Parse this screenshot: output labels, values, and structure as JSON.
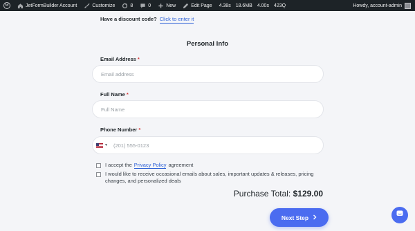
{
  "adminbar": {
    "site_name": "JetFormBuilder Account",
    "customize": "Customize",
    "updates_count": "8",
    "comments_count": "0",
    "new_label": "New",
    "edit_page": "Edit Page",
    "metrics": [
      "4.38s",
      "18.6MB",
      "4.00s",
      "423Q"
    ],
    "howdy": "Howdy, account-admin"
  },
  "discount": {
    "label": "Have a discount code?",
    "link": "Click to enter it"
  },
  "section_title": "Personal Info",
  "fields": {
    "email": {
      "label": "Email Address",
      "required_mark": "*",
      "placeholder": "Email address"
    },
    "name": {
      "label": "Full Name",
      "required_mark": "*",
      "placeholder": "Full Name"
    },
    "phone": {
      "label": "Phone Number",
      "required_mark": "*",
      "placeholder": "(201) 555-0123",
      "country_icon": "us-flag-icon"
    }
  },
  "consent": {
    "accept_prefix": "I accept the",
    "policy_link": "Privacy Policy",
    "accept_suffix": "agreement",
    "marketing": "I would like to receive occasional emails about sales, important updates & releases, pricing changes, and personalized deals"
  },
  "total": {
    "label": "Purchase Total:",
    "amount": "$129.00"
  },
  "next_button": {
    "label": "Next Step",
    "icon": "chevron-right-icon"
  },
  "colors": {
    "accent": "#4b6cf0",
    "link": "#2b5fd6",
    "required": "#d63638",
    "adminbar": "#1d2327"
  }
}
